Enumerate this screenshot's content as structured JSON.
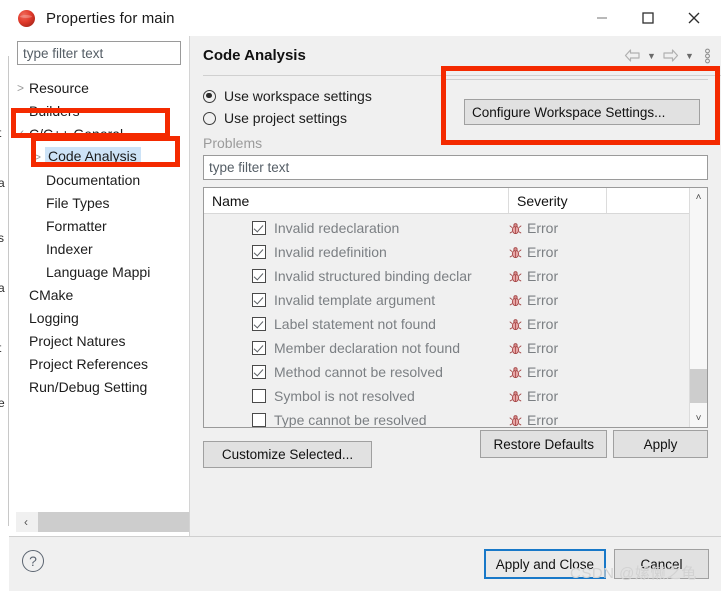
{
  "window": {
    "title": "Properties for main",
    "icon": "eclipse-sphere-icon",
    "minimize_label": "Minimize",
    "maximize_label": "Maximize",
    "close_label": "Close"
  },
  "tree": {
    "filter_placeholder": "type filter text",
    "filter_value": "",
    "items": [
      {
        "label": "Resource",
        "indent": 0,
        "twisty": ">",
        "selected": false
      },
      {
        "label": "Builders",
        "indent": 0,
        "twisty": "",
        "selected": false
      },
      {
        "label": "C/C++ General",
        "indent": 0,
        "twisty": "v",
        "selected": false
      },
      {
        "label": "Code Analysis",
        "indent": 1,
        "twisty": ">",
        "selected": true
      },
      {
        "label": "Documentation",
        "indent": 1,
        "twisty": "",
        "selected": false
      },
      {
        "label": "File Types",
        "indent": 1,
        "twisty": "",
        "selected": false
      },
      {
        "label": "Formatter",
        "indent": 1,
        "twisty": "",
        "selected": false
      },
      {
        "label": "Indexer",
        "indent": 1,
        "twisty": "",
        "selected": false
      },
      {
        "label": "Language Mappi",
        "indent": 1,
        "twisty": "",
        "selected": false
      },
      {
        "label": "CMake",
        "indent": 0,
        "twisty": "",
        "selected": false
      },
      {
        "label": "Logging",
        "indent": 0,
        "twisty": "",
        "selected": false
      },
      {
        "label": "Project Natures",
        "indent": 0,
        "twisty": "",
        "selected": false
      },
      {
        "label": "Project References",
        "indent": 0,
        "twisty": "",
        "selected": false
      },
      {
        "label": "Run/Debug Setting",
        "indent": 0,
        "twisty": "",
        "selected": false
      }
    ],
    "hscroll_left_label": "‹",
    "hscroll_right_label": "›"
  },
  "content": {
    "title": "Code Analysis",
    "toolbar": {
      "back_label": "Back",
      "back_menu_label": "▼",
      "forward_label": "Forward",
      "forward_menu_label": "▼",
      "menu_label": "View Menu"
    },
    "radios": [
      {
        "label": "Use workspace settings",
        "selected": true
      },
      {
        "label": "Use project settings",
        "selected": false
      }
    ],
    "configure_button": "Configure Workspace Settings...",
    "problems_group_label": "Problems",
    "table_filter_placeholder": "type filter text",
    "table_filter_value": "",
    "table": {
      "columns": [
        "Name",
        "Severity",
        ""
      ],
      "rows": [
        {
          "checked": true,
          "name": "Invalid redeclaration",
          "severity": "Error"
        },
        {
          "checked": true,
          "name": "Invalid redefinition",
          "severity": "Error"
        },
        {
          "checked": true,
          "name": "Invalid structured binding declar",
          "severity": "Error"
        },
        {
          "checked": true,
          "name": "Invalid template argument",
          "severity": "Error"
        },
        {
          "checked": true,
          "name": "Label statement not found",
          "severity": "Error"
        },
        {
          "checked": true,
          "name": "Member declaration not found",
          "severity": "Error"
        },
        {
          "checked": true,
          "name": "Method cannot be resolved",
          "severity": "Error"
        },
        {
          "checked": false,
          "name": "Symbol is not resolved",
          "severity": "Error"
        },
        {
          "checked": false,
          "name": "Type cannot be resolved",
          "severity": "Error"
        }
      ],
      "scroll_up_label": "˄",
      "scroll_down_label": "˅"
    },
    "customize_button": "Customize Selected...",
    "restore_defaults_button": "Restore Defaults",
    "apply_button": "Apply"
  },
  "footer": {
    "help_label": "?",
    "apply_and_close_button": "Apply and Close",
    "cancel_button": "Cancel"
  },
  "annotations": {
    "color": "#f42a00",
    "boxes": [
      "ccpp-general-highlight",
      "code-analysis-highlight",
      "configure-workspace-highlight"
    ]
  },
  "watermark": "CSDN @嫘懒之龟",
  "background_bleed": [
    "t",
    "a",
    "s",
    "a",
    "t",
    "e"
  ],
  "colors": {
    "selection": "#cde3f7",
    "panel": "#f0f0f0",
    "accent": "#1878c8",
    "error": "#c14a4a",
    "annotation": "#f42a00"
  }
}
